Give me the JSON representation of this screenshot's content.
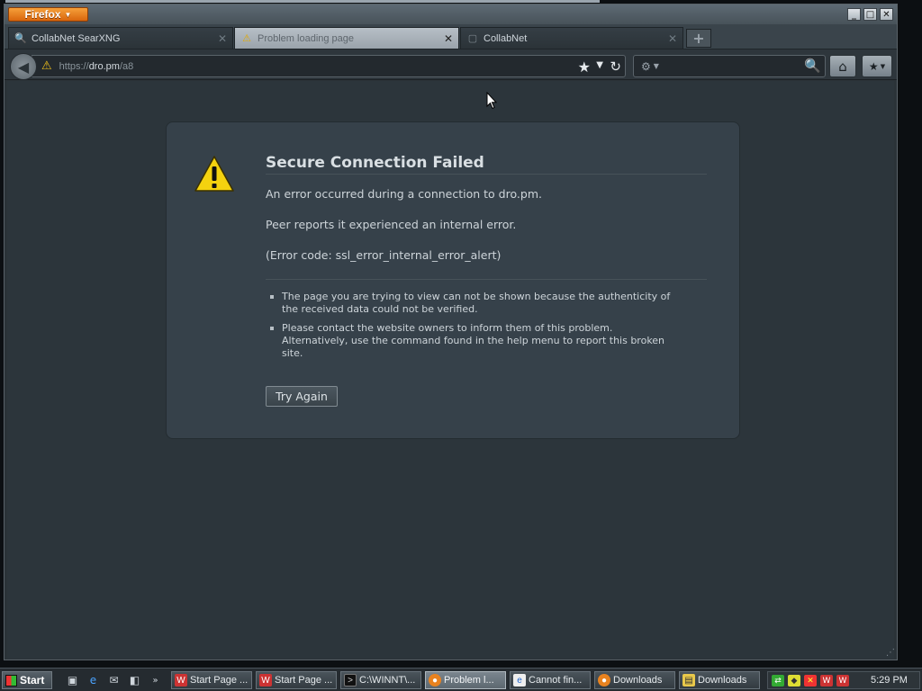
{
  "window": {
    "menu_button": "Firefox",
    "controls": {
      "minimize": "_",
      "maximize": "□",
      "close": "✕"
    }
  },
  "tabs": [
    {
      "label": "CollabNet SearXNG",
      "icon": "search-favicon",
      "active": false
    },
    {
      "label": "Problem loading page",
      "icon": "warning-icon",
      "active": true
    },
    {
      "label": "CollabNet",
      "icon": "page-favicon",
      "active": false
    }
  ],
  "navbar": {
    "url_scheme": "https://",
    "url_host": "dro.pm",
    "url_path": "/a8",
    "search_placeholder": ""
  },
  "error_page": {
    "title": "Secure Connection Failed",
    "line1": "An error occurred during a connection to dro.pm.",
    "line2": "Peer reports it experienced an internal error.",
    "code": "(Error code: ssl_error_internal_error_alert)",
    "bullets": [
      "The page you are trying to view can not be shown because the authenticity of the received data could not be verified.",
      "Please contact the website owners to inform them of this problem. Alternatively, use the command found in the help menu to report this broken site."
    ],
    "try_again": "Try Again"
  },
  "taskbar": {
    "start": "Start",
    "buttons": [
      {
        "label": "Start Page ...",
        "icon": "wiki-icon",
        "active": false
      },
      {
        "label": "Start Page ...",
        "icon": "wiki-icon",
        "active": false
      },
      {
        "label": "C:\\WINNT\\...",
        "icon": "console-icon",
        "active": false
      },
      {
        "label": "Problem l...",
        "icon": "firefox-icon",
        "active": true
      },
      {
        "label": "Cannot fin...",
        "icon": "ie-icon",
        "active": false
      },
      {
        "label": "Downloads",
        "icon": "firefox-icon",
        "active": false
      },
      {
        "label": "Downloads",
        "icon": "folder-icon",
        "active": false
      }
    ],
    "clock": "5:29 PM"
  },
  "colors": {
    "accent_orange": "#e8821f",
    "warning_yellow": "#f2c21b",
    "window_bg": "#2c353b"
  }
}
